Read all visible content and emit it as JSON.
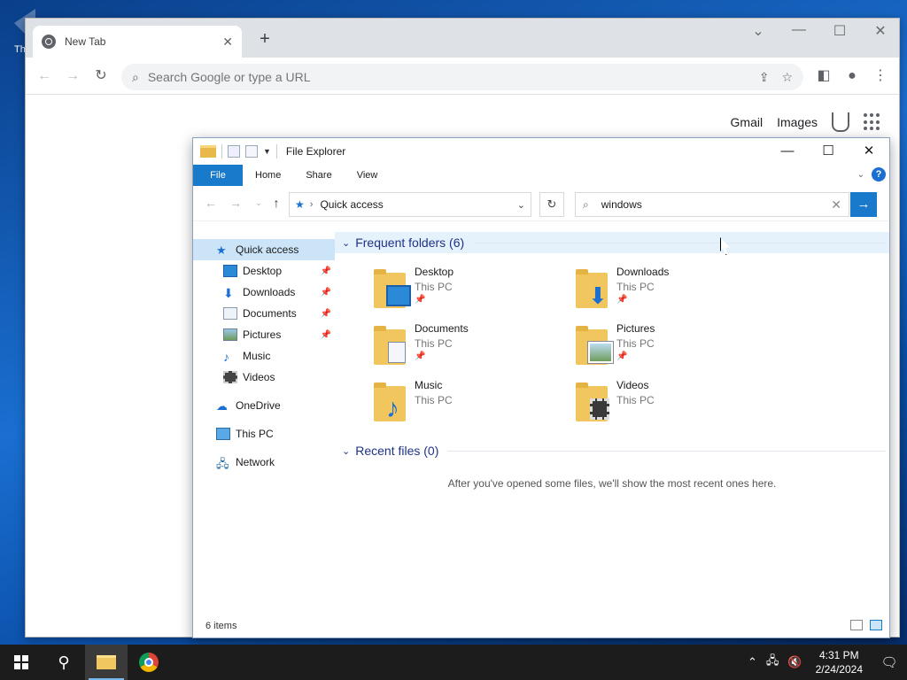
{
  "desktop": {
    "icon_label": "Th"
  },
  "chrome": {
    "tab_title": "New Tab",
    "tab_close": "✕",
    "new_tab": "+",
    "omnibox_placeholder": "Search Google or type a URL",
    "ntp_links": {
      "gmail": "Gmail",
      "images": "Images"
    }
  },
  "explorer": {
    "title": "File Explorer",
    "ribbon_tabs": [
      "File",
      "Home",
      "Share",
      "View"
    ],
    "address": "Quick access",
    "search_value": "windows",
    "nav": [
      {
        "label": "Quick access"
      },
      {
        "label": "Desktop"
      },
      {
        "label": "Downloads"
      },
      {
        "label": "Documents"
      },
      {
        "label": "Pictures"
      },
      {
        "label": "Music"
      },
      {
        "label": "Videos"
      },
      {
        "label": "OneDrive"
      },
      {
        "label": "This PC"
      },
      {
        "label": "Network"
      }
    ],
    "frequent_header": "Frequent folders (6)",
    "folders": [
      {
        "name": "Desktop",
        "location": "This PC",
        "pinned": true
      },
      {
        "name": "Downloads",
        "location": "This PC",
        "pinned": true
      },
      {
        "name": "Documents",
        "location": "This PC",
        "pinned": true
      },
      {
        "name": "Pictures",
        "location": "This PC",
        "pinned": true
      },
      {
        "name": "Music",
        "location": "This PC",
        "pinned": false
      },
      {
        "name": "Videos",
        "location": "This PC",
        "pinned": false
      }
    ],
    "recent_header": "Recent files (0)",
    "recent_empty_message": "After you've opened some files, we'll show the most recent ones here.",
    "status": "6 items"
  },
  "taskbar": {
    "time": "4:31 PM",
    "date": "2/24/2024"
  }
}
